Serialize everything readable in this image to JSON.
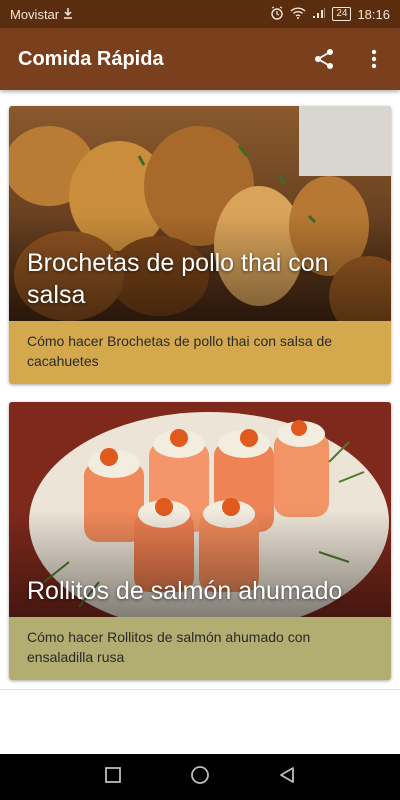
{
  "status_bar": {
    "carrier": "Movistar",
    "battery": "24",
    "time": "18:16"
  },
  "app_bar": {
    "title": "Comida Rápida",
    "share_icon": "share-icon",
    "menu_icon": "more-vert-icon"
  },
  "recipes": [
    {
      "title": "Brochetas de pollo thai con salsa",
      "description": "Cómo hacer Brochetas de pollo thai con salsa de cacahuetes",
      "accent_color": "#d4a94e"
    },
    {
      "title": "Rollitos de salmón ahumado",
      "description": "Cómo hacer Rollitos de salmón ahumado con ensaladilla rusa",
      "accent_color": "#b2ad71"
    }
  ],
  "colors": {
    "status_bar": "#5a2d0f",
    "app_bar": "#7a3f1c",
    "nav_bar": "#000000"
  }
}
